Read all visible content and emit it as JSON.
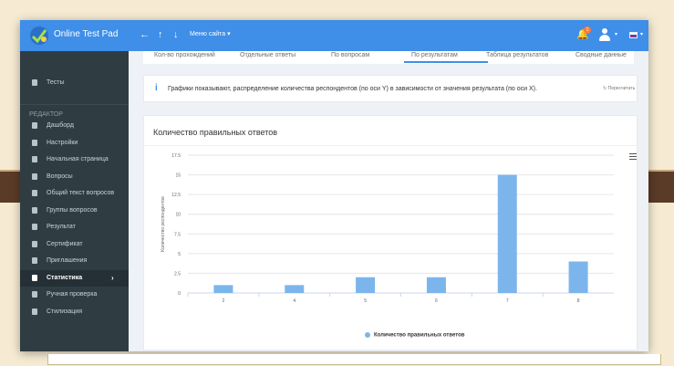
{
  "app": {
    "title": "Online Test Pad"
  },
  "topbar": {
    "back_icon": "arrow-left-icon",
    "upload_icon": "arrow-up-icon",
    "download_icon": "arrow-down-icon",
    "menu_label": "Меню сайта",
    "notification_count": "1",
    "language": "RU",
    "accent_color": "#3f8ee7"
  },
  "sidebar": {
    "section_label": "РЕДАКТОР",
    "top_item": {
      "label": "Тесты",
      "icon": "tests-icon"
    },
    "items": [
      {
        "label": "Дашборд",
        "icon": "dashboard-icon"
      },
      {
        "label": "Настройки",
        "icon": "settings-icon"
      },
      {
        "label": "Начальная страница",
        "icon": "start-page-icon"
      },
      {
        "label": "Вопросы",
        "icon": "questions-icon"
      },
      {
        "label": "Общий текст вопросов",
        "icon": "common-text-icon"
      },
      {
        "label": "Группы вопросов",
        "icon": "question-groups-icon"
      },
      {
        "label": "Результат",
        "icon": "result-icon"
      },
      {
        "label": "Сертификат",
        "icon": "certificate-icon"
      },
      {
        "label": "Приглашения",
        "icon": "invitations-icon"
      },
      {
        "label": "Статистика",
        "icon": "statistics-icon",
        "active": true
      },
      {
        "label": "Ручная проверка",
        "icon": "manual-check-icon"
      },
      {
        "label": "Стилизация",
        "icon": "styling-icon"
      }
    ]
  },
  "tabs": [
    {
      "label": "Кол-во прохождений"
    },
    {
      "label": "Отдельные ответы"
    },
    {
      "label": "По вопросам"
    },
    {
      "label": "По результатам",
      "active": true
    },
    {
      "label": "Таблица результатов"
    },
    {
      "label": "Сводные данные"
    }
  ],
  "info": {
    "text": "Графики показывают, распределение количества респондентов (по оси Y) в зависимости от значения результата (по оси X).",
    "recalc_label": "Пересчитать"
  },
  "card": {
    "title": "Количество правильных ответов"
  },
  "chart_data": {
    "type": "bar",
    "categories": [
      "2",
      "4",
      "5",
      "6",
      "7",
      "8"
    ],
    "series": [
      {
        "name": "Количество правильных ответов",
        "values": [
          1,
          1,
          2,
          2,
          15,
          4
        ],
        "color": "#7cb5ec"
      }
    ],
    "ylabel": "Количество респондентов",
    "xlabel": "",
    "ylim": [
      0,
      17.5
    ],
    "yticks": [
      "0",
      "2.5",
      "5",
      "7.5",
      "10",
      "12.5",
      "15",
      "17.5"
    ],
    "grid": true,
    "legend": "bottom-center"
  }
}
